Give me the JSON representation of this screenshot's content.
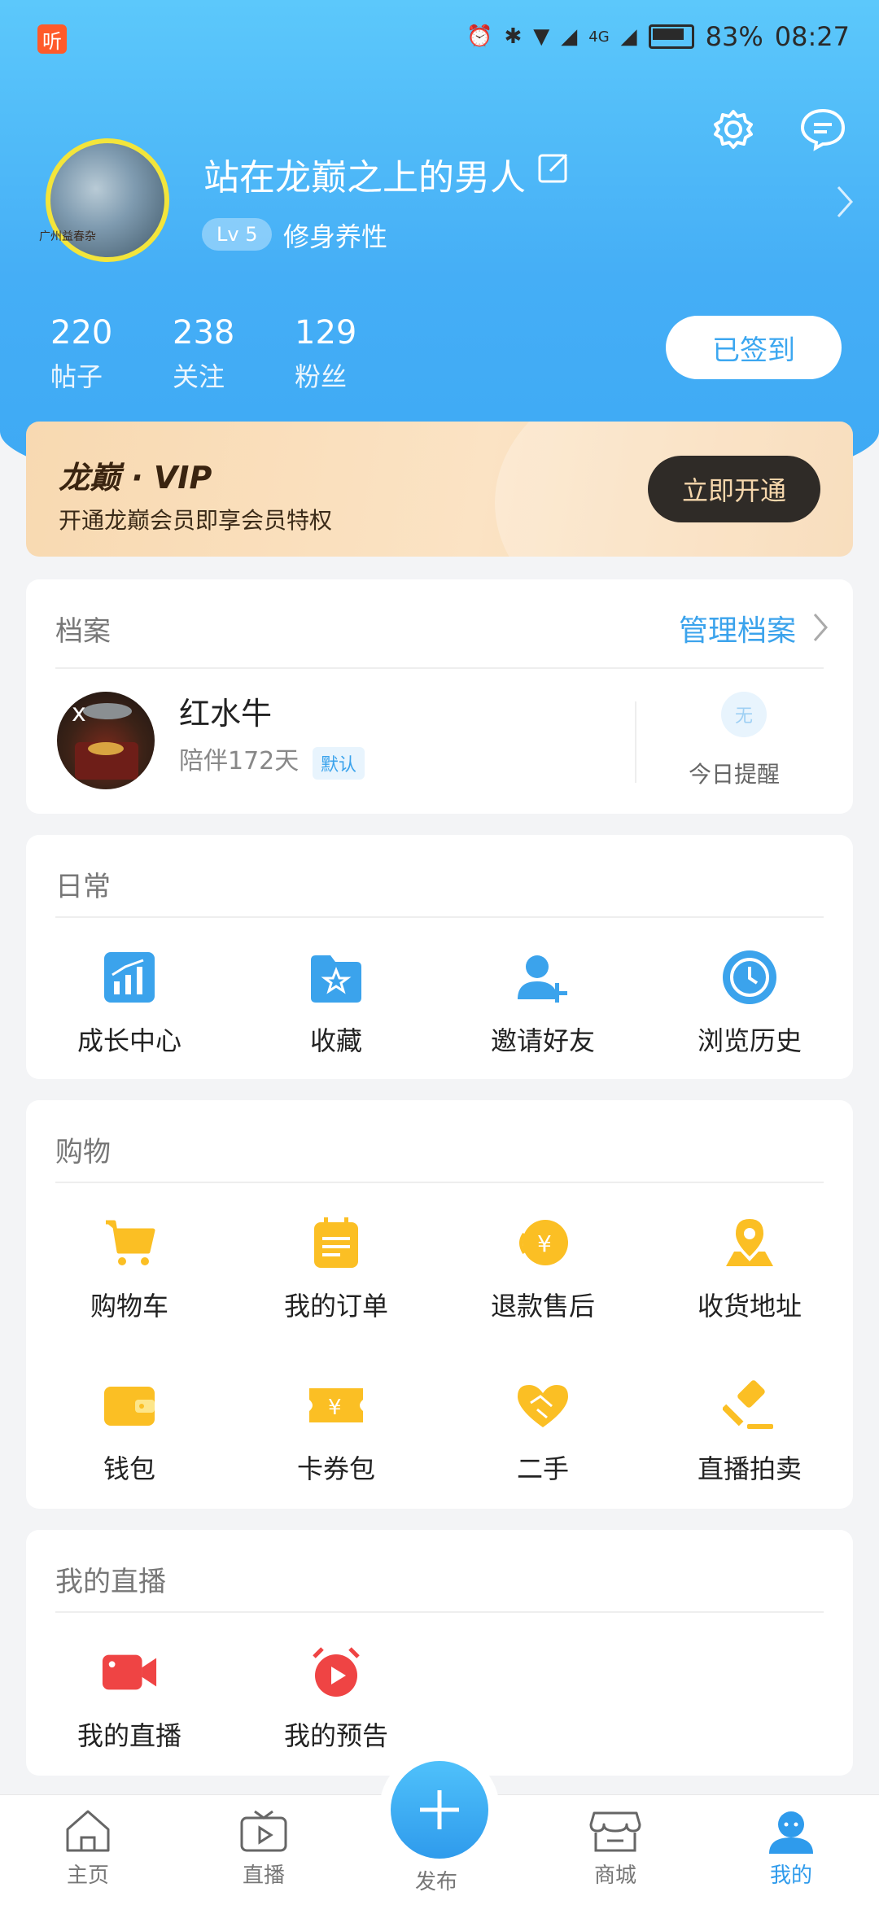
{
  "status_bar": {
    "app_badge": "听",
    "network": "4G",
    "battery": "83%",
    "time": "08:27"
  },
  "profile": {
    "username": "站在龙巅之上的男人",
    "level": "Lv 5",
    "motto": "修身养性",
    "avatar_caption": "广州益春杂",
    "stats": [
      {
        "value": "220",
        "label": "帖子"
      },
      {
        "value": "238",
        "label": "关注"
      },
      {
        "value": "129",
        "label": "粉丝"
      }
    ],
    "signin_label": "已签到"
  },
  "vip": {
    "title": "龙巅 · VIP",
    "subtitle": "开通龙巅会员即享会员特权",
    "button": "立即开通"
  },
  "archive": {
    "title": "档案",
    "manage": "管理档案",
    "pet_name": "红水牛",
    "pet_days": "陪伴172天",
    "pet_tag": "默认",
    "reminder_icon_text": "无",
    "reminder_label": "今日提醒"
  },
  "daily": {
    "title": "日常",
    "items": [
      {
        "label": "成长中心",
        "icon": "growth-chart-icon"
      },
      {
        "label": "收藏",
        "icon": "star-folder-icon"
      },
      {
        "label": "邀请好友",
        "icon": "add-friend-icon"
      },
      {
        "label": "浏览历史",
        "icon": "clock-icon"
      }
    ]
  },
  "shopping": {
    "title": "购物",
    "items": [
      {
        "label": "购物车",
        "icon": "cart-icon"
      },
      {
        "label": "我的订单",
        "icon": "order-icon"
      },
      {
        "label": "退款售后",
        "icon": "refund-icon"
      },
      {
        "label": "收货地址",
        "icon": "location-icon"
      },
      {
        "label": "钱包",
        "icon": "wallet-icon"
      },
      {
        "label": "卡券包",
        "icon": "coupon-icon"
      },
      {
        "label": "二手",
        "icon": "handshake-icon"
      },
      {
        "label": "直播拍卖",
        "icon": "auction-hammer-icon"
      }
    ]
  },
  "live": {
    "title": "我的直播",
    "items": [
      {
        "label": "我的直播",
        "icon": "video-camera-icon"
      },
      {
        "label": "我的预告",
        "icon": "alarm-play-icon"
      }
    ]
  },
  "tabbar": {
    "items": [
      {
        "label": "主页",
        "icon": "home-icon"
      },
      {
        "label": "直播",
        "icon": "tv-icon"
      },
      {
        "label": "发布",
        "icon": "plus-icon"
      },
      {
        "label": "商城",
        "icon": "store-icon"
      },
      {
        "label": "我的",
        "icon": "user-icon"
      }
    ],
    "active": "我的"
  },
  "colors": {
    "header_blue": "#45aef6",
    "accent_blue": "#2f9bec",
    "vip_gold": "#f8d9b1",
    "shopping_yellow": "#fbbf24",
    "live_red": "#ef4444"
  }
}
